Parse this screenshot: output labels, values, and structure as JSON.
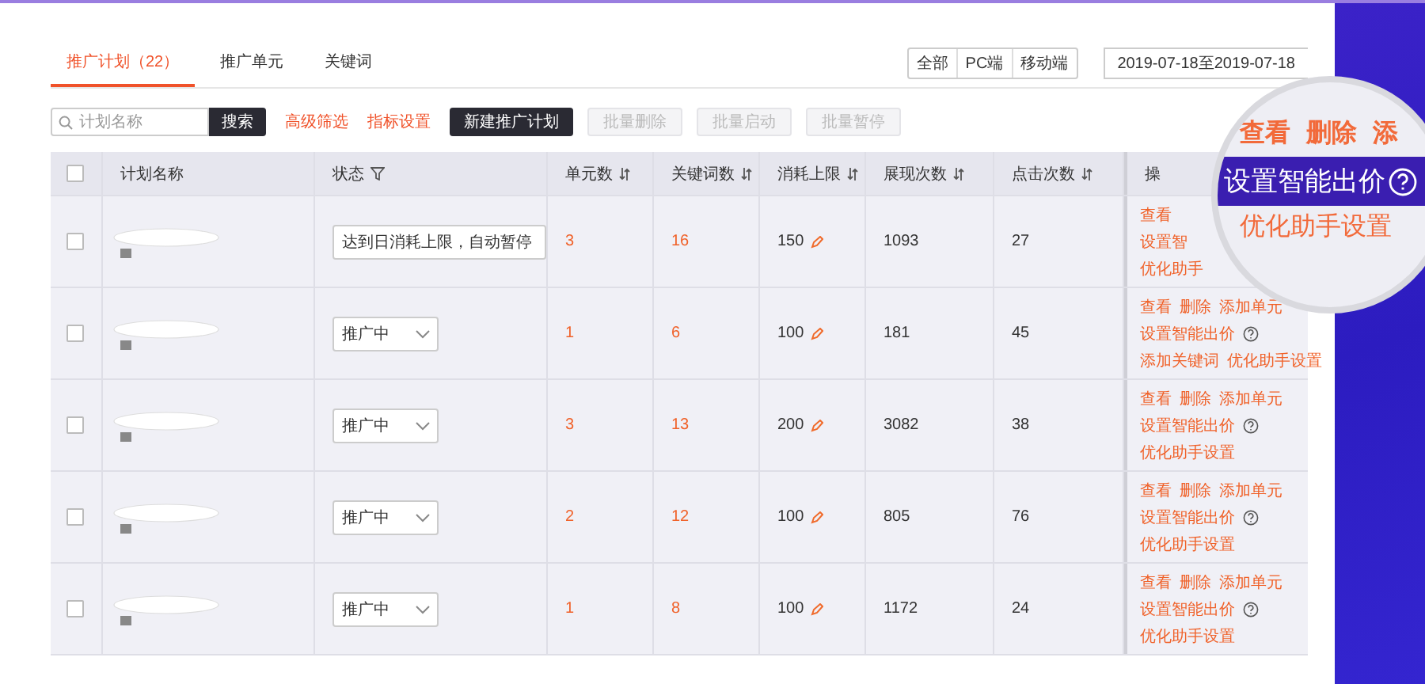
{
  "tabs": [
    {
      "label": "推广计划（22）",
      "selected": true
    },
    {
      "label": "推广单元",
      "selected": false
    },
    {
      "label": "关键词",
      "selected": false
    }
  ],
  "device_filter": [
    "全部",
    "PC端",
    "移动端"
  ],
  "date_range": "2019-07-18至2019-07-18",
  "search": {
    "placeholder": "计划名称",
    "button": "搜索"
  },
  "toolbar": [
    {
      "label": "高级筛选",
      "kind": "link",
      "disabled": false
    },
    {
      "label": "指标设置",
      "kind": "link",
      "disabled": false
    },
    {
      "label": "新建推广计划",
      "kind": "primary",
      "disabled": false
    },
    {
      "label": "批量删除",
      "kind": "plain",
      "disabled": true
    },
    {
      "label": "批量启动",
      "kind": "plain",
      "disabled": true
    },
    {
      "label": "批量暂停",
      "kind": "plain",
      "disabled": true
    }
  ],
  "table": {
    "select_all": false,
    "columns": [
      {
        "label": "计划名称",
        "kind": "plain"
      },
      {
        "label": "状态",
        "kind": "filter"
      },
      {
        "label": "单元数",
        "kind": "sort"
      },
      {
        "label": "关键词数",
        "kind": "sort"
      },
      {
        "label": "消耗上限",
        "kind": "sort"
      },
      {
        "label": "展现次数",
        "kind": "sort"
      },
      {
        "label": "点击次数",
        "kind": "sort"
      },
      {
        "label": "操",
        "kind": "plain"
      }
    ],
    "rows": [
      {
        "checked": false,
        "status": "达到日消耗上限，自动暂停",
        "units": "3",
        "keywords": "16",
        "budget": "150",
        "impressions": "1093",
        "clicks": "27",
        "actions": [
          {
            "links": [
              "查看"
            ],
            "help": false
          },
          {
            "links": [
              "设置智"
            ],
            "help": false
          },
          {
            "links": [
              "优化助手"
            ],
            "help": false
          }
        ]
      },
      {
        "checked": false,
        "status": "推广中",
        "units": "1",
        "keywords": "6",
        "budget": "100",
        "impressions": "181",
        "clicks": "45",
        "actions": [
          {
            "links": [
              "查看",
              "删除",
              "添加单元"
            ],
            "help": false
          },
          {
            "links": [
              "设置智能出价"
            ],
            "help": true
          },
          {
            "links": [
              "添加关键词",
              "优化助手设置"
            ],
            "help": false
          }
        ]
      },
      {
        "checked": false,
        "status": "推广中",
        "units": "3",
        "keywords": "13",
        "budget": "200",
        "impressions": "3082",
        "clicks": "38",
        "actions": [
          {
            "links": [
              "查看",
              "删除",
              "添加单元"
            ],
            "help": false
          },
          {
            "links": [
              "设置智能出价"
            ],
            "help": true
          },
          {
            "links": [
              "优化助手设置"
            ],
            "help": false
          }
        ]
      },
      {
        "checked": false,
        "status": "推广中",
        "units": "2",
        "keywords": "12",
        "budget": "100",
        "impressions": "805",
        "clicks": "76",
        "actions": [
          {
            "links": [
              "查看",
              "删除",
              "添加单元"
            ],
            "help": false
          },
          {
            "links": [
              "设置智能出价"
            ],
            "help": true
          },
          {
            "links": [
              "优化助手设置"
            ],
            "help": false
          }
        ]
      },
      {
        "checked": false,
        "status": "推广中",
        "units": "1",
        "keywords": "8",
        "budget": "100",
        "impressions": "1172",
        "clicks": "24",
        "actions": [
          {
            "links": [
              "查看",
              "删除",
              "添加单元"
            ],
            "help": false
          },
          {
            "links": [
              "设置智能出价"
            ],
            "help": true
          },
          {
            "links": [
              "优化助手设置"
            ],
            "help": false
          }
        ]
      }
    ]
  },
  "magnifier": {
    "top_links": [
      "查看",
      "删除",
      "添"
    ],
    "highlight": "设置智能出价",
    "help": true,
    "bottom_link": "优化助手设置"
  }
}
